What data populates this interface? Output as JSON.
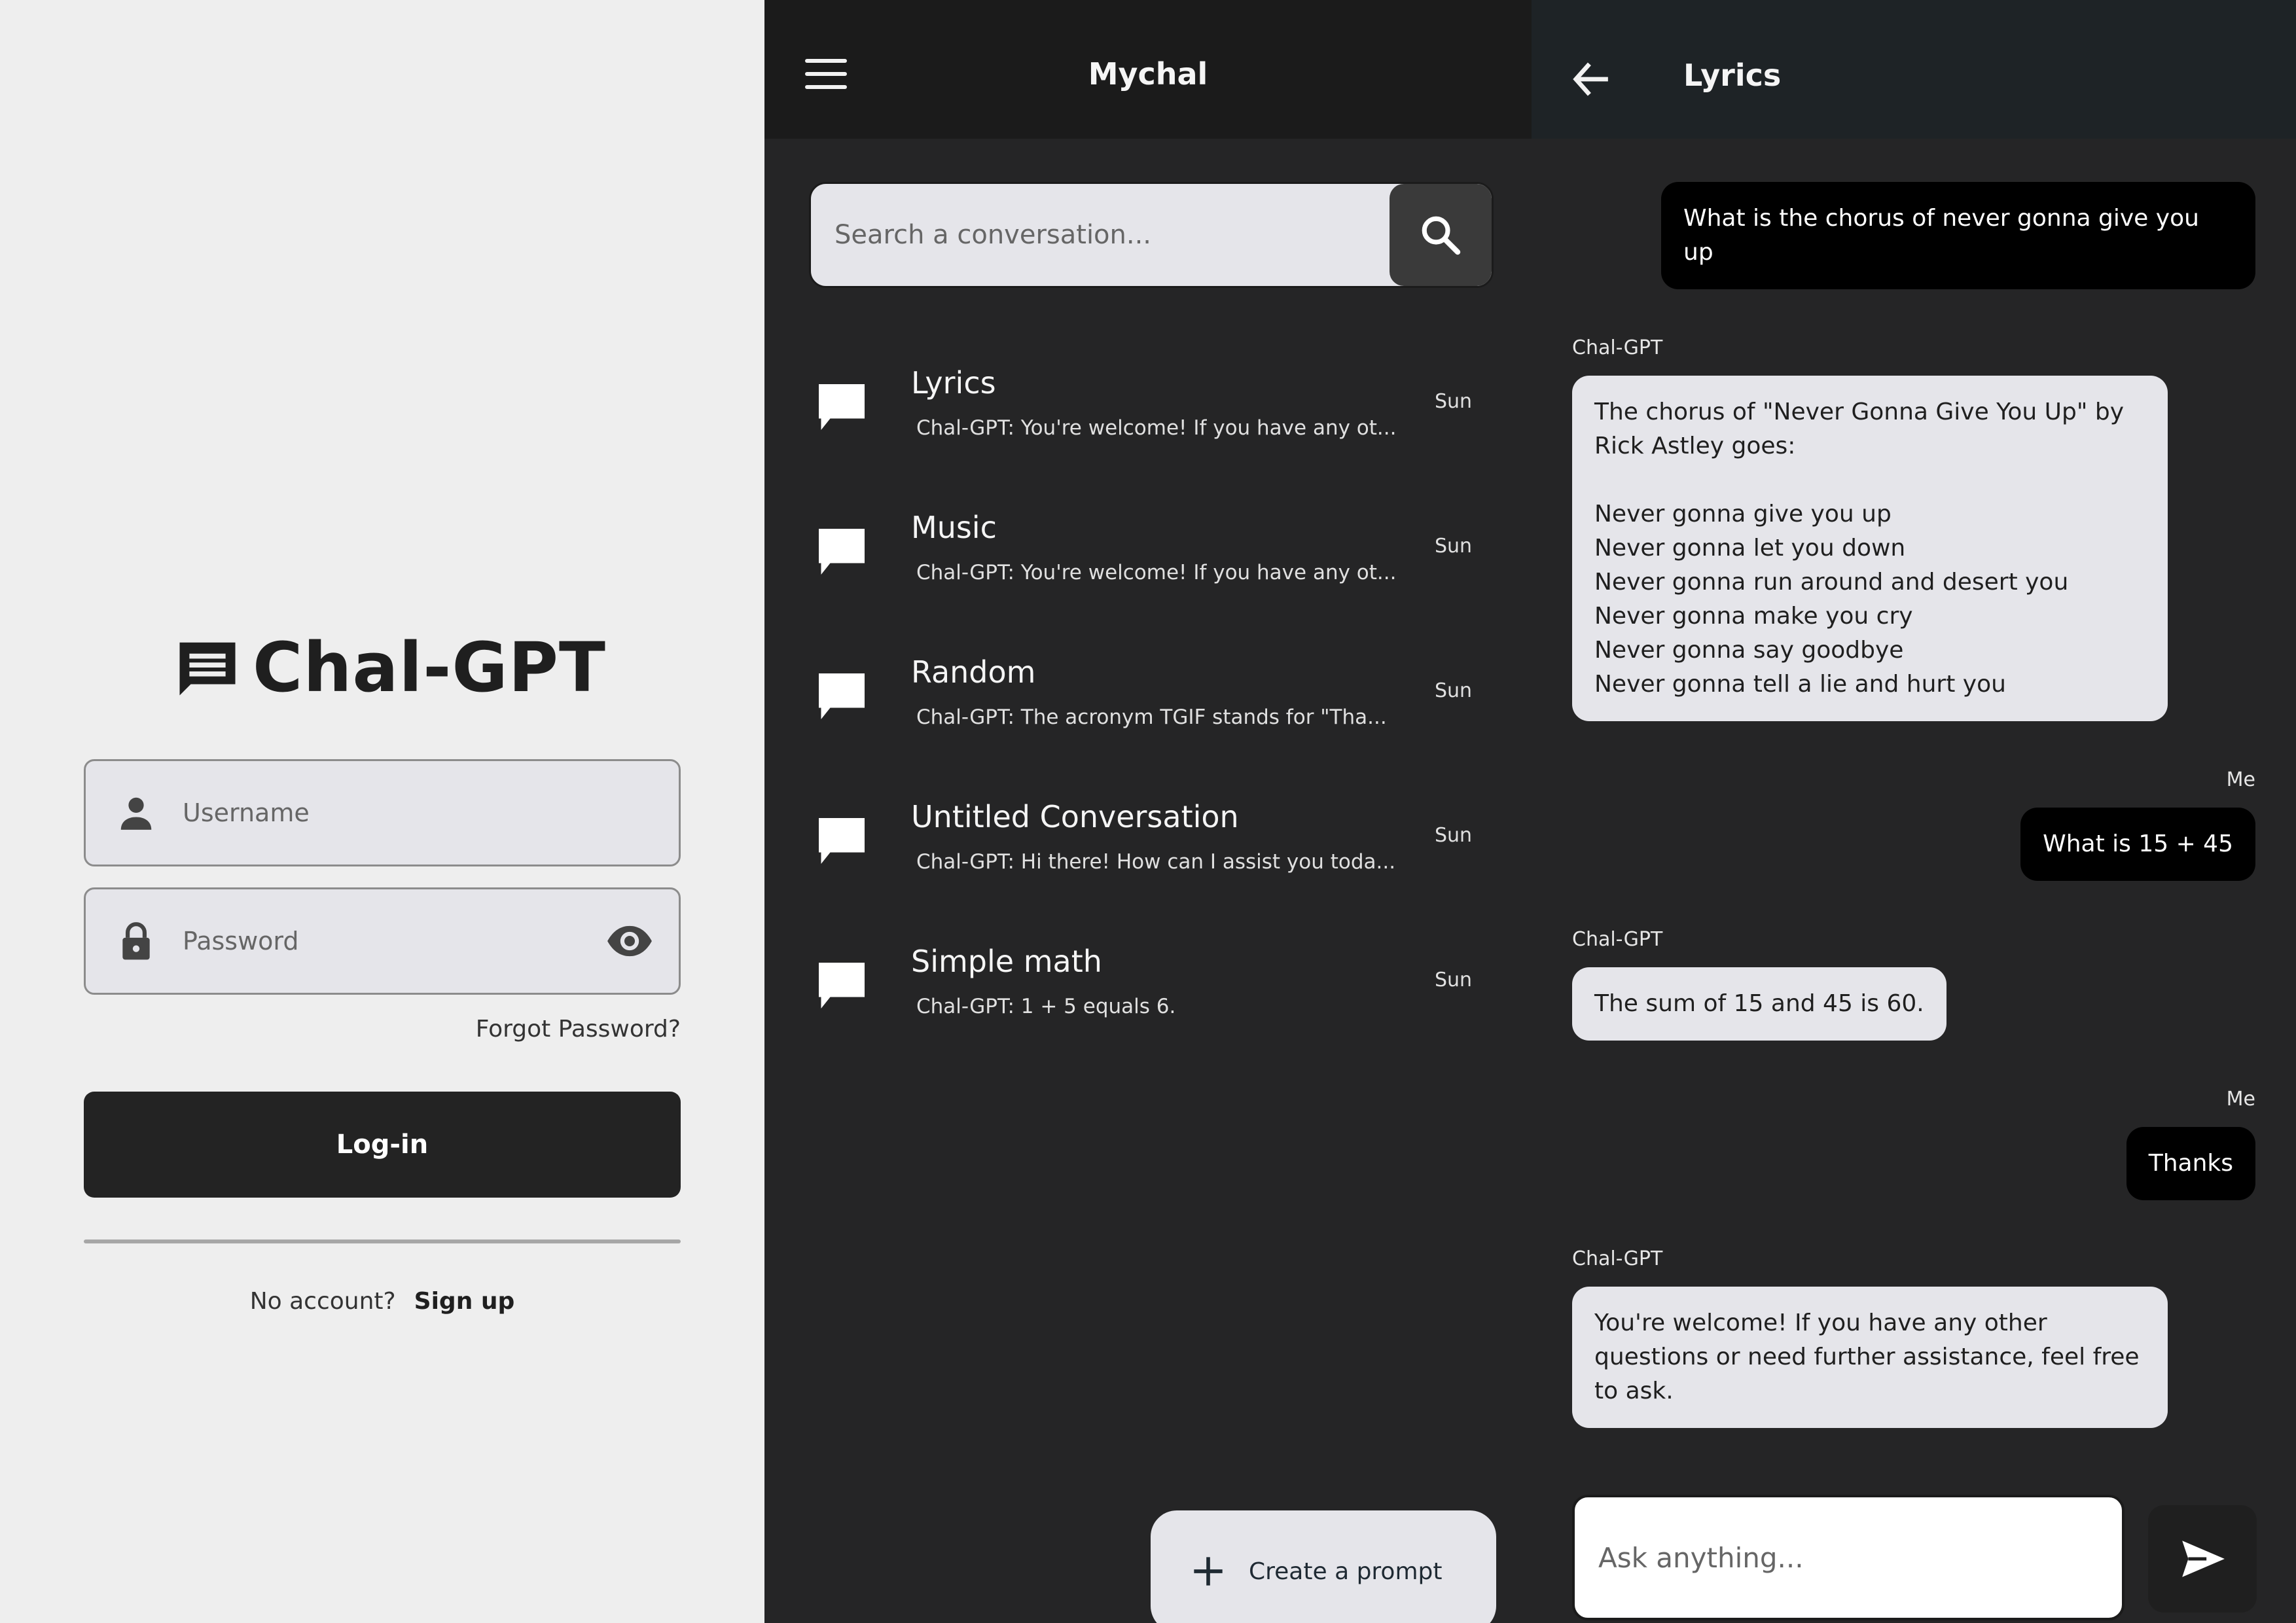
{
  "login": {
    "app_title": "Chal-GPT",
    "username_placeholder": "Username",
    "password_placeholder": "Password",
    "forgot_password": "Forgot Password?",
    "login_button": "Log-in",
    "no_account": "No account?",
    "sign_up": "Sign up"
  },
  "list": {
    "title": "Mychal",
    "search_placeholder": "Search a conversation...",
    "conversations": [
      {
        "name": "Lyrics",
        "preview": "Chal-GPT: You're welcome! If you have any ot...",
        "day": "Sun"
      },
      {
        "name": "Music",
        "preview": "Chal-GPT: You're welcome! If you have any ot...",
        "day": "Sun"
      },
      {
        "name": "Random",
        "preview": "Chal-GPT: The acronym TGIF stands for \"Tha...",
        "day": "Sun"
      },
      {
        "name": "Untitled Conversation",
        "preview": "Chal-GPT: Hi there! How can I assist you toda...",
        "day": "Sun"
      },
      {
        "name": "Simple math",
        "preview": "Chal-GPT: 1 + 5 equals 6.",
        "day": "Sun"
      }
    ],
    "create_prompt": "Create a prompt"
  },
  "chat": {
    "title": "Lyrics",
    "messages": [
      {
        "sender": "",
        "text": "What is the chorus of never gonna give you up"
      },
      {
        "sender": "Chal-GPT",
        "text": "The chorus of \"Never Gonna Give You Up\" by Rick Astley goes:\n\nNever gonna give you up\nNever gonna let you down\nNever gonna run around and desert you\nNever gonna make you cry\nNever gonna say goodbye\nNever gonna tell a lie and hurt you"
      },
      {
        "sender": "Me",
        "text": "What is 15 + 45"
      },
      {
        "sender": "Chal-GPT",
        "text": "The sum of 15 and 45 is 60."
      },
      {
        "sender": "Me",
        "text": "Thanks"
      },
      {
        "sender": "Chal-GPT",
        "text": "You're welcome! If you have any other questions or need further assistance, feel free to ask."
      }
    ],
    "input_placeholder": "Ask anything..."
  },
  "icons": {
    "logo": "chat-lines-icon",
    "user": "person-icon",
    "lock": "lock-icon",
    "eye": "eye-icon",
    "menu": "hamburger-menu-icon",
    "search": "search-icon",
    "conversation": "chat-bubble-icon",
    "plus": "plus-icon",
    "back": "arrow-left-icon",
    "send": "send-icon"
  }
}
